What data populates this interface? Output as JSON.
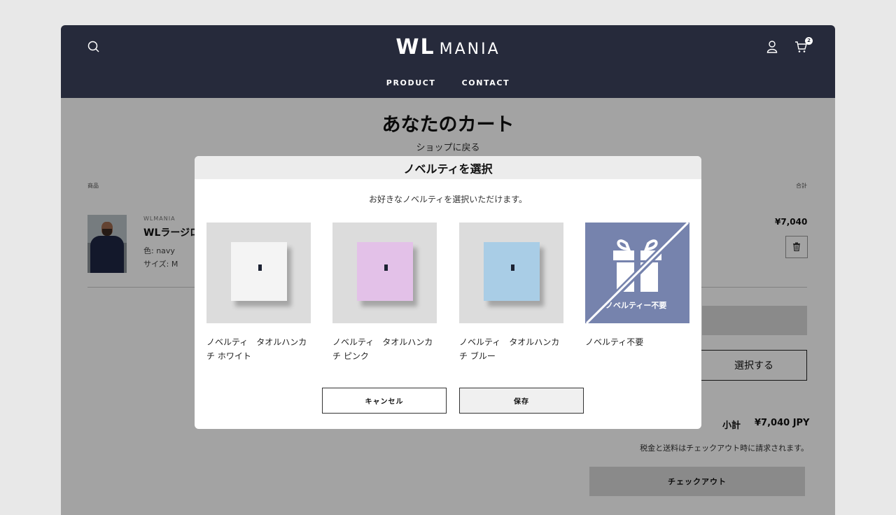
{
  "header": {
    "logo_wl": "WL",
    "logo_mania": "MANIA",
    "nav": [
      "PRODUCT",
      "CONTACT"
    ],
    "cart_count": "2",
    "colors": {
      "header_bg": "#262a3b"
    }
  },
  "cart": {
    "title": "あなたのカート",
    "back_link": "ショップに戻る",
    "col_product": "商品",
    "col_total": "合計",
    "item": {
      "brand": "WLMANIA",
      "name": "WLラージロ",
      "color": "色: navy",
      "size": "サイズ: M",
      "price": "¥7,040"
    },
    "select_button": "選択する",
    "subtotal_label": "小計",
    "subtotal_value": "¥7,040 JPY",
    "tax_note": "税金と送料はチェックアウト時に請求されます。",
    "checkout_button": "チェックアウト"
  },
  "modal": {
    "title": "ノベルティを選択",
    "subtitle": "お好きなノベルティを選択いただけます。",
    "options": [
      {
        "label": "ノベルティ　タオルハンカチ ホワイト",
        "color": "#f4f4f4"
      },
      {
        "label": "ノベルティ　タオルハンカチ ピンク",
        "color": "#e3c1e8"
      },
      {
        "label": "ノベルティ　タオルハンカチ ブルー",
        "color": "#a9cde6"
      },
      {
        "label": "ノベルティ不要",
        "color": "#7683ad",
        "image_text": "ノベルティー不要"
      }
    ],
    "cancel_button": "キャンセル",
    "save_button": "保存"
  }
}
